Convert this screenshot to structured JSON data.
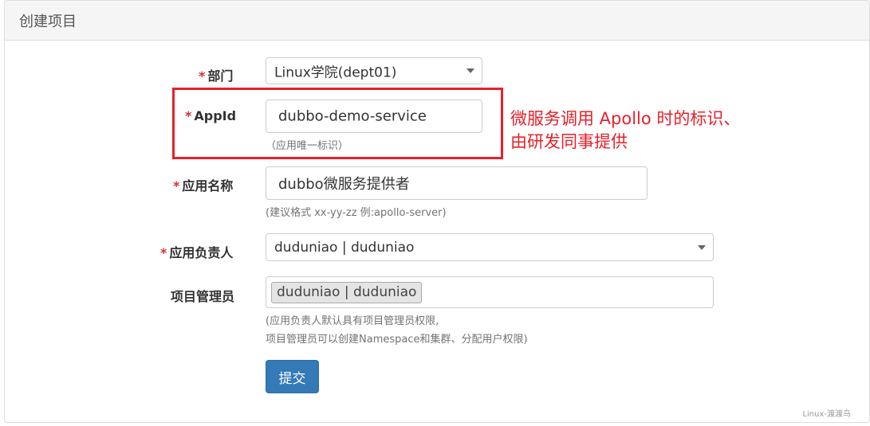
{
  "panel": {
    "title": "创建项目"
  },
  "form": {
    "required_mark": "*",
    "department": {
      "label": "部门",
      "selected": "Linux学院(dept01)"
    },
    "appid": {
      "label": "AppId",
      "value": "dubbo-demo-service",
      "help": "（应用唯一标识）"
    },
    "app_name": {
      "label": "应用名称",
      "value": "dubbo微服务提供者",
      "help": "(建议格式 xx-yy-zz 例:apollo-server)"
    },
    "owner": {
      "label": "应用负责人",
      "selected": "duduniao | duduniao"
    },
    "admins": {
      "label": "项目管理员",
      "tags": [
        "duduniao | duduniao"
      ],
      "help_line1": "(应用负责人默认具有项目管理员权限,",
      "help_line2": "项目管理员可以创建Namespace和集群、分配用户权限)"
    },
    "submit_label": "提交"
  },
  "annotation": {
    "line1": "微服务调用 Apollo 时的标识、",
    "line2": "由研发同事提供",
    "color": "#e8202a"
  },
  "watermark": "Linux-渡渡鸟",
  "colors": {
    "primary": "#337ab7",
    "required": "#d9302c"
  }
}
